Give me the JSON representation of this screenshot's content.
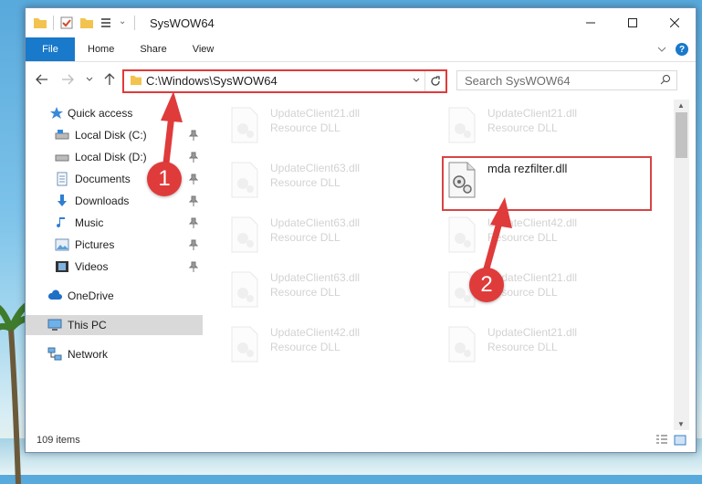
{
  "window": {
    "title": "SysWOW64",
    "tabs": [
      "File",
      "Home",
      "Share",
      "View"
    ],
    "help_label": "?"
  },
  "address": {
    "path": "C:\\Windows\\SysWOW64"
  },
  "search": {
    "placeholder": "Search SysWOW64"
  },
  "sidebar": {
    "items": [
      {
        "label": "Quick access",
        "icon": "star-icon"
      },
      {
        "label": "Local Disk (C:)",
        "icon": "drive-icon",
        "pinned": true
      },
      {
        "label": "Local Disk (D:)",
        "icon": "drive-icon",
        "pinned": true
      },
      {
        "label": "Documents",
        "icon": "documents-icon",
        "pinned": true
      },
      {
        "label": "Downloads",
        "icon": "download-icon",
        "pinned": true
      },
      {
        "label": "Music",
        "icon": "music-icon",
        "pinned": true
      },
      {
        "label": "Pictures",
        "icon": "pictures-icon",
        "pinned": true
      },
      {
        "label": "Videos",
        "icon": "videos-icon",
        "pinned": true
      },
      {
        "label": "OneDrive",
        "icon": "cloud-icon"
      },
      {
        "label": "This PC",
        "icon": "computer-icon",
        "selected": true
      },
      {
        "label": "Network",
        "icon": "network-icon"
      }
    ]
  },
  "files": [
    {
      "name": "UpdateClient21.dll",
      "type": "Resource DLL"
    },
    {
      "name": "UpdateClient21.dll",
      "type": "Resource DLL"
    },
    {
      "name": "UpdateClient63.dll",
      "type": "Resource DLL"
    },
    {
      "name": "mda rezfilter.dll",
      "type": ""
    },
    {
      "name": "UpdateClient63.dll",
      "type": "Resource DLL"
    },
    {
      "name": "UpdateClient42.dll",
      "type": "Resource DLL"
    },
    {
      "name": "UpdateClient63.dll",
      "type": "Resource DLL"
    },
    {
      "name": "UpdateClient21.dll",
      "type": "Resource DLL"
    },
    {
      "name": "UpdateClient42.dll",
      "type": "Resource DLL"
    },
    {
      "name": "UpdateClient21.dll",
      "type": "Resource DLL"
    }
  ],
  "status": {
    "item_count": "109 items"
  },
  "annotations": {
    "step1": "1",
    "step2": "2"
  },
  "colors": {
    "accent": "#1979ca",
    "annotation_red": "#df3b3b"
  }
}
